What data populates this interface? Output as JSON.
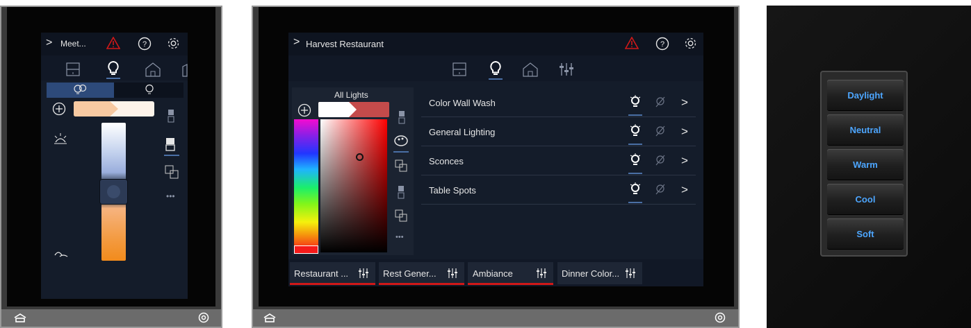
{
  "panel1": {
    "header_title": "Meet...",
    "slider_level": 0.5
  },
  "panel2": {
    "header_title": "Harvest Restaurant",
    "color_label": "All Lights",
    "zones": [
      {
        "name": "Color Wall Wash"
      },
      {
        "name": "General Lighting"
      },
      {
        "name": "Sconces"
      },
      {
        "name": "Table Spots"
      }
    ],
    "scenes": [
      {
        "label": "Restaurant ..."
      },
      {
        "label": "Rest Gener..."
      },
      {
        "label": "Ambiance"
      },
      {
        "label": "Dinner Color..."
      }
    ]
  },
  "keypad": {
    "buttons": [
      "Daylight",
      "Neutral",
      "Warm",
      "Cool",
      "Soft"
    ],
    "text_color": "#4da6ff"
  },
  "colors": {
    "warning": "#d01818",
    "ui_bg": "#141c2a",
    "accent": "#4a6fa5"
  }
}
